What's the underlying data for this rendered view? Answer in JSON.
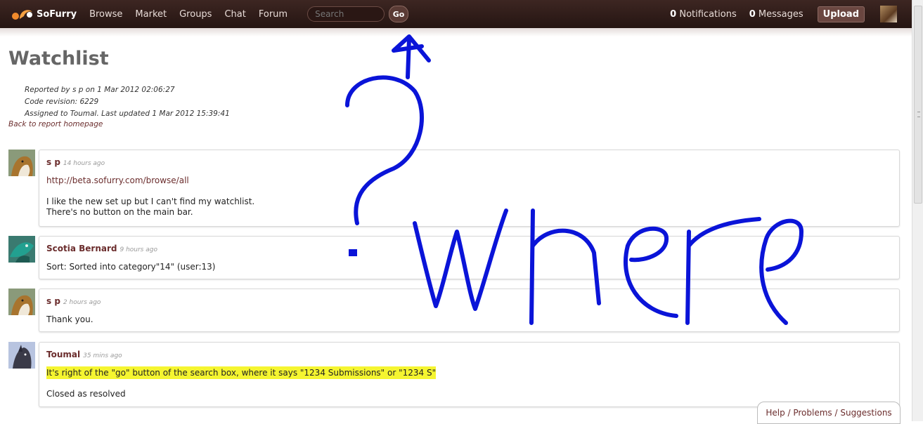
{
  "topbar": {
    "site_name": "SoFurry",
    "nav": [
      "Browse",
      "Market",
      "Groups",
      "Chat",
      "Forum"
    ],
    "search_placeholder": "Search",
    "go_label": "Go",
    "notifications_count": "0",
    "notifications_label": "Notifications",
    "messages_count": "0",
    "messages_label": "Messages",
    "upload_label": "Upload"
  },
  "page": {
    "title": "Watchlist",
    "meta": [
      "Reported by s p on 1 Mar 2012 02:06:27",
      "Code revision: 6229",
      "Assigned to Toumal. Last updated 1 Mar 2012 15:39:41"
    ],
    "back_link": "Back to report homepage"
  },
  "comments": [
    {
      "author": "s p",
      "time": "14 hours ago",
      "url": "http://beta.sofurry.com/browse/all",
      "lines": [
        "I like the new set up but I can't find my watchlist.",
        "There's no button on the main bar."
      ]
    },
    {
      "author": "Scotia Bernard",
      "time": "9 hours ago",
      "lines": [
        "Sort: Sorted into category\"14\" (user:13)"
      ]
    },
    {
      "author": "s p",
      "time": "2 hours ago",
      "lines": [
        "Thank you."
      ]
    },
    {
      "author": "Toumal",
      "time": "35 mins ago",
      "highlight": "It's right of the \"go\" button of the search box, where it says \"1234 Submissions\" or \"1234 S\"",
      "lines": [
        "Closed as resolved"
      ]
    }
  ],
  "footer": {
    "help_label": "Help / Problems / Suggestions"
  },
  "annotation": {
    "text": "where",
    "color": "#0a14d8",
    "highlight_color": "#f5f530"
  }
}
